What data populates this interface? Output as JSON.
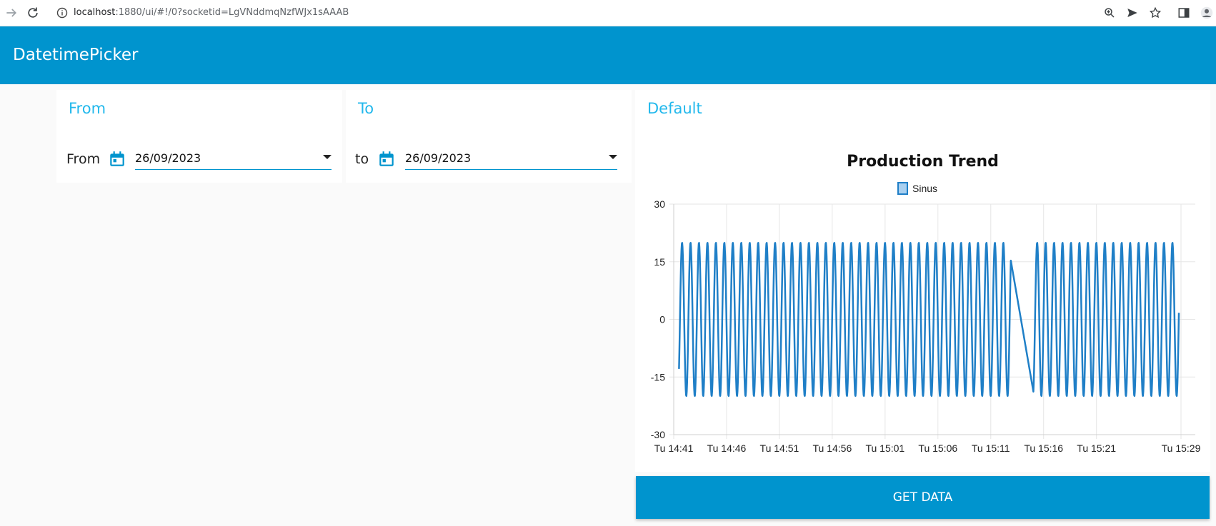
{
  "browser": {
    "url_host": "localhost",
    "url_rest": ":1880/ui/#!/0?socketid=LgVNddmqNzfWJx1sAAAB"
  },
  "app": {
    "title": "DatetimePicker"
  },
  "from_card": {
    "title": "From",
    "label": "From",
    "date": "26/09/2023"
  },
  "to_card": {
    "title": "To",
    "label": "to",
    "date": "26/09/2023"
  },
  "default_card": {
    "title": "Default"
  },
  "button": {
    "label": "GET DATA"
  },
  "colors": {
    "accent": "#0094ce",
    "title": "#22b8ec",
    "series": "#1f7fc7"
  },
  "chart_data": {
    "type": "line",
    "title": "Production Trend",
    "legend": {
      "position": "top",
      "entries": [
        "Sinus"
      ]
    },
    "grid": true,
    "ylim": [
      -30,
      30
    ],
    "y_ticks": [
      30,
      15,
      0,
      -15,
      -30
    ],
    "x_tick_labels": [
      "Tu 14:41",
      "Tu 14:46",
      "Tu 14:51",
      "Tu 14:56",
      "Tu 15:01",
      "Tu 15:06",
      "Tu 15:11",
      "Tu 15:16",
      "Tu 15:21",
      "Tu 15:29"
    ],
    "xlim_minutes": [
      "14:41",
      "15:29"
    ],
    "series": [
      {
        "name": "Sinus",
        "amplitude": 20,
        "period_minutes": 0.8,
        "start": "14:41.5",
        "end": "15:28.8",
        "gap": [
          "15:12.9",
          "15:15.0"
        ]
      }
    ]
  }
}
